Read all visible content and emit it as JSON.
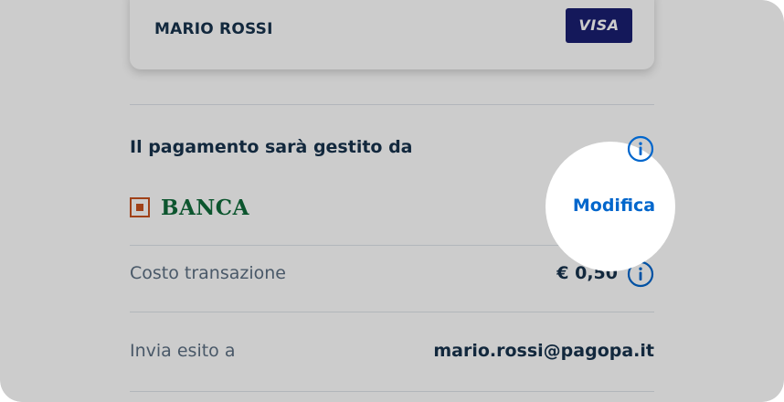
{
  "card": {
    "holder": "MARIO ROSSI",
    "brand": "VISA"
  },
  "psp": {
    "heading": "Il pagamento sarà gestito da",
    "bank_name": "BANCA",
    "modify_label": "Modifica",
    "info_icon": "info-icon"
  },
  "fee": {
    "label": "Costo transazione",
    "value": "€ 0,50",
    "info_icon": "info-icon"
  },
  "outcome": {
    "label": "Invia esito a",
    "email": "mario.rossi@pagopa.it"
  },
  "colors": {
    "primary": "#0066cc",
    "text_dark": "#17324d",
    "text_muted": "#5c6f82",
    "visa_blue": "#1a1f71",
    "bank_green": "#0f6b3a",
    "bank_orange": "#c8521f"
  }
}
